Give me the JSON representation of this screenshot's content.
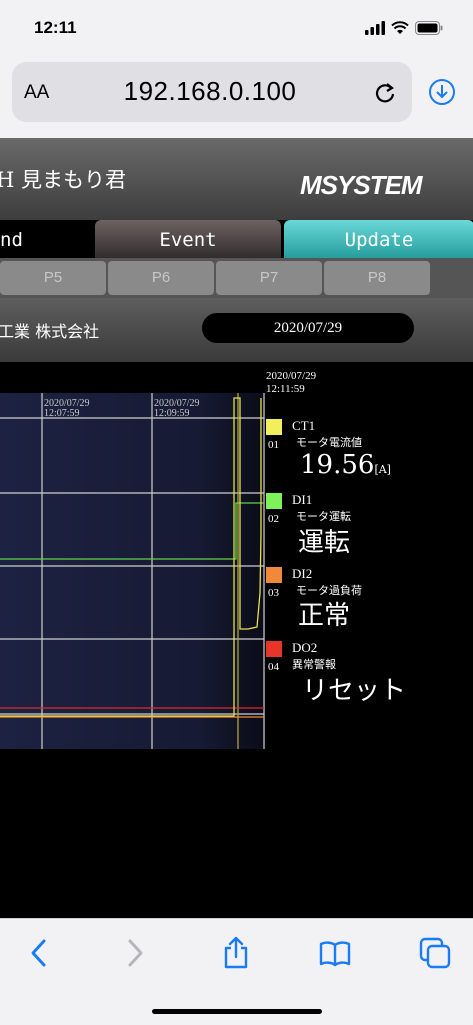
{
  "status_bar": {
    "time": "12:11"
  },
  "browser": {
    "text_size_label": "AA",
    "url": "192.168.0.100"
  },
  "app": {
    "title": "H 見まもり君",
    "brand": "MSYSTEM",
    "tabs": [
      {
        "label": "nd",
        "state": "active"
      },
      {
        "label": "Event"
      },
      {
        "label": "Update"
      }
    ],
    "pages": [
      "P5",
      "P6",
      "P7",
      "P8"
    ],
    "company": "工業 株式会社",
    "date": "2020/07/29"
  },
  "chart_data": {
    "type": "line",
    "current_time": [
      "2020/07/29",
      "12:11:59"
    ],
    "x_tick_labels": [
      [
        "2020/07/29",
        "12:07:59"
      ],
      [
        "2020/07/29",
        "12:09:59"
      ]
    ],
    "grid": true,
    "series": [
      {
        "name": "CT1",
        "color": "#e6e24a"
      },
      {
        "name": "DI1",
        "color": "#5fd34a"
      },
      {
        "name": "DI2",
        "color": "#f28a34"
      },
      {
        "name": "DO2",
        "color": "#e0282a"
      }
    ]
  },
  "channels": [
    {
      "color": "#f3ee5b",
      "num": "01",
      "name": "CT1",
      "desc": "モータ電流値",
      "value": "19.56",
      "unit": "[A]"
    },
    {
      "color": "#7ef05a",
      "num": "02",
      "name": "DI1",
      "desc": "モータ運転",
      "value": "運転"
    },
    {
      "color": "#f08a3a",
      "num": "03",
      "name": "DI2",
      "desc": "モータ過負荷",
      "value": "正常"
    },
    {
      "color": "#e8352a",
      "num": "04",
      "name": "DO2",
      "desc": "異常警報",
      "value": "リセット"
    }
  ]
}
